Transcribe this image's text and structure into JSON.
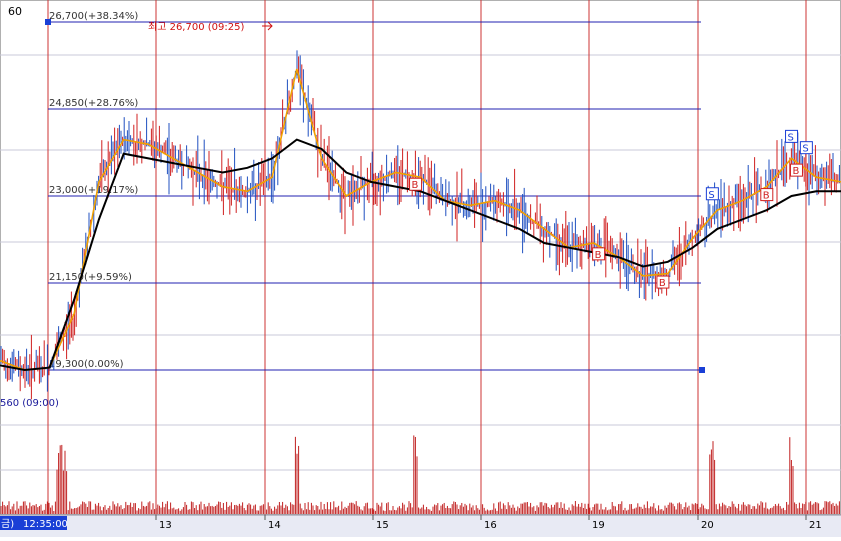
{
  "header": {
    "period_label": "60"
  },
  "colors": {
    "gridline_vertical": "#cc3333",
    "gridline_horizontal": "#c8c8d8",
    "fib_line": "#2020b0",
    "fib_handle": "#1a3fd6",
    "price_bar": "#d02020",
    "price_bar_down": "#2050c0",
    "ma_short": "#f0a000",
    "ma_long": "#000000",
    "volume_bar": "#c02020",
    "high_annotation": "#d01010",
    "signal_buy": "#d02020",
    "signal_sell": "#1a3fd6",
    "axis_bg": "#e8eaf4",
    "current_time_bg": "#1a3fd6"
  },
  "annotations": {
    "high_marker_text": "최고 26,700 (09:25)",
    "low_marker_text": "560 (09:00)"
  },
  "x_axis": {
    "current_time_label": "12:35:00",
    "clipped_weekday_label": "금)",
    "dates": [
      "13",
      "14",
      "15",
      "16",
      "19",
      "20",
      "21"
    ]
  },
  "chart_data": {
    "type": "line",
    "title": "",
    "ylim": [
      17000,
      28500
    ],
    "fib_levels": [
      {
        "price": 26700,
        "label": "26,700(+38.34%)"
      },
      {
        "price": 24850,
        "label": "24,850(+28.76%)"
      },
      {
        "price": 23000,
        "label": "23,000(+19.17%)"
      },
      {
        "price": 21150,
        "label": "21,150(+9.59%)"
      },
      {
        "price": 19300,
        "label": "19,300(0.00%)"
      }
    ],
    "session_boundaries": [
      "13",
      "14",
      "15",
      "16",
      "19",
      "20",
      "21"
    ],
    "series": [
      {
        "name": "",
        "role": "short_ma",
        "x": [
          0,
          5,
          10,
          15,
          20,
          25,
          30,
          35,
          40,
          45,
          50,
          55,
          60,
          65,
          70,
          75,
          80,
          85,
          90,
          95,
          100,
          105,
          110,
          115,
          120,
          125,
          130,
          135,
          140,
          145,
          150,
          155,
          160,
          165,
          170
        ],
        "values": [
          19500,
          19300,
          19350,
          20500,
          23300,
          24200,
          24100,
          23800,
          23500,
          23200,
          23100,
          23400,
          25700,
          23800,
          23000,
          23300,
          23500,
          23400,
          22900,
          22800,
          22900,
          22700,
          22300,
          21900,
          22000,
          21700,
          21300,
          21350,
          22100,
          22700,
          22900,
          23200,
          23800,
          23400,
          23300
        ]
      },
      {
        "name": "",
        "role": "long_ma",
        "x": [
          0,
          5,
          10,
          15,
          20,
          25,
          30,
          35,
          40,
          45,
          50,
          55,
          60,
          65,
          70,
          75,
          80,
          85,
          90,
          95,
          100,
          105,
          110,
          115,
          120,
          125,
          130,
          135,
          140,
          145,
          150,
          155,
          160,
          165,
          170
        ],
        "values": [
          19400,
          19300,
          19350,
          20800,
          22500,
          23900,
          23800,
          23700,
          23600,
          23500,
          23600,
          23800,
          24200,
          24000,
          23500,
          23300,
          23200,
          23100,
          22900,
          22700,
          22500,
          22300,
          22000,
          21900,
          21800,
          21700,
          21500,
          21600,
          21900,
          22300,
          22500,
          22700,
          23000,
          23100,
          23100
        ]
      }
    ],
    "volume": {
      "peaks_at": [
        12,
        13,
        60,
        84,
        144,
        160
      ],
      "baseline": "low"
    },
    "signals": [
      {
        "type": "B",
        "x": 84
      },
      {
        "type": "B",
        "x": 121
      },
      {
        "type": "B",
        "x": 134
      },
      {
        "type": "S",
        "x": 144
      },
      {
        "type": "S",
        "x": 160
      },
      {
        "type": "S",
        "x": 163
      },
      {
        "type": "B",
        "x": 161
      },
      {
        "type": "B",
        "x": 155
      }
    ],
    "high": {
      "price": 26700
    },
    "start": {
      "price": 19300
    }
  }
}
